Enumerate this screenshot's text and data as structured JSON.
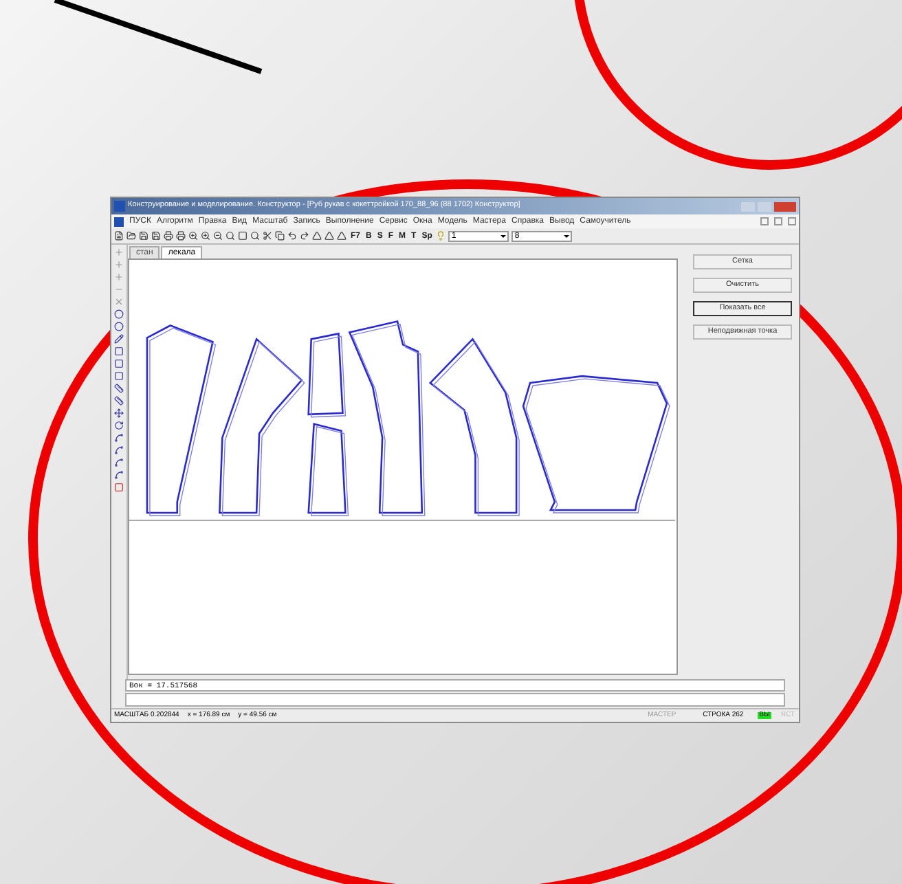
{
  "window": {
    "title": "Конструирование и моделирование. Конструктор - [Руб рукав с кокеттройкой 170_88_96 (88 1702) Конструктор]",
    "menu": [
      "ПУСК",
      "Алгоритм",
      "Правка",
      "Вид",
      "Масштаб",
      "Запись",
      "Выполнение",
      "Сервис",
      "Окна",
      "Модель",
      "Мастера",
      "Справка",
      "Вывод",
      "Самоучитель"
    ]
  },
  "toolbar": {
    "text_buttons": [
      "F7",
      "B",
      "S",
      "F",
      "M",
      "T",
      "Sp"
    ],
    "dropdowns": [
      "1",
      "8"
    ]
  },
  "tabs": [
    {
      "label": "стан",
      "selected": false
    },
    {
      "label": "лекала",
      "selected": true
    }
  ],
  "side_buttons": [
    {
      "label": "Сетка",
      "selected": false
    },
    {
      "label": "Очистить",
      "selected": false
    },
    {
      "label": "Показать все",
      "selected": true
    },
    {
      "label": "Неподвижная точка",
      "selected": false
    }
  ],
  "command_line": {
    "value": "Вок = 17.517568"
  },
  "status_bar": {
    "scale": "МАСШТАБ 0.202844",
    "x": "x = 176.89 см",
    "y": "y = 49.56 см",
    "mode": "МАСТЕР",
    "line": "СТРОКА 262",
    "indicators": [
      {
        "label": "ВЫ",
        "on": true
      },
      {
        "label": "ЯСТ",
        "on": false
      }
    ]
  }
}
